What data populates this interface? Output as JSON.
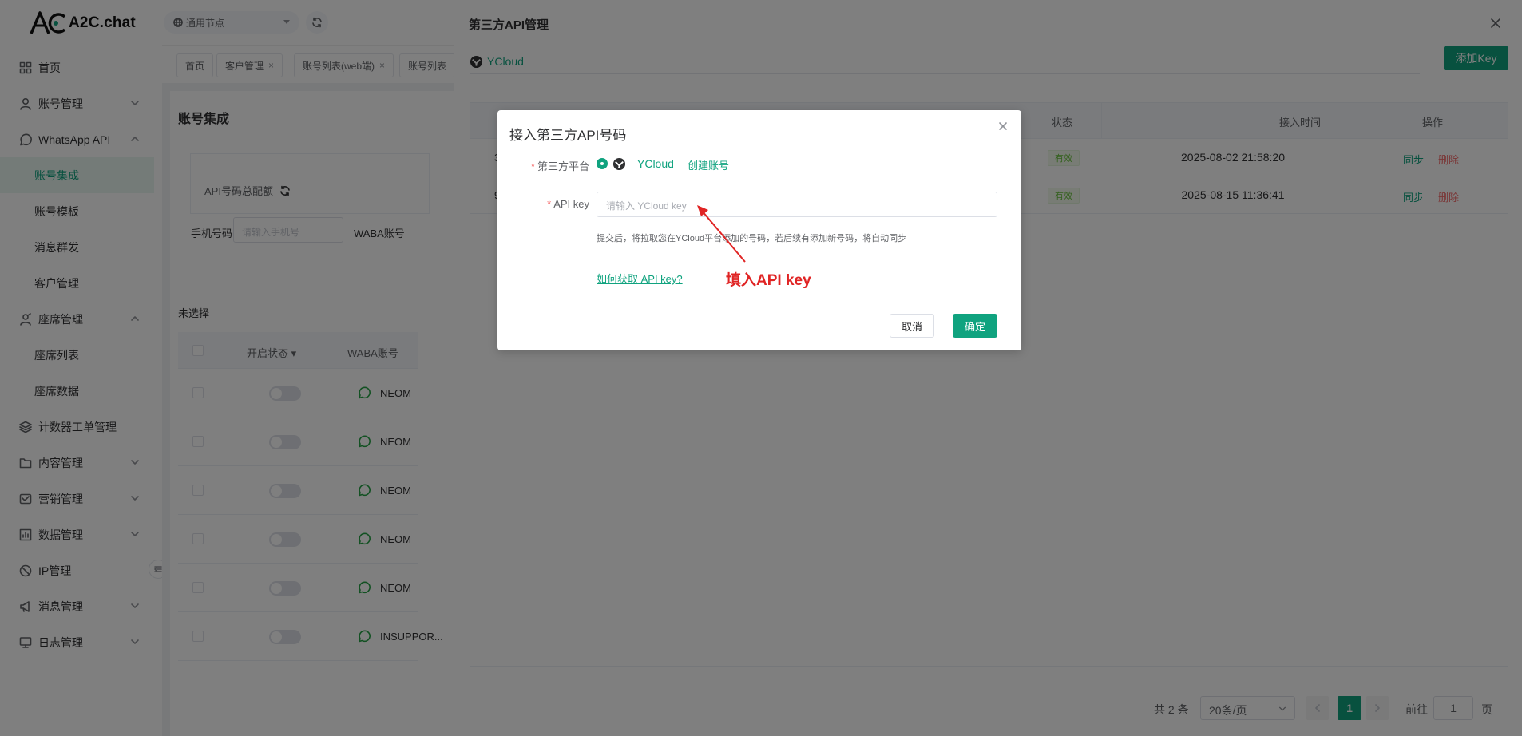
{
  "app": {
    "name": "A2C.chat"
  },
  "topbar": {
    "node_select": "通用节点"
  },
  "sidebar": {
    "items": [
      {
        "label": "首页",
        "icon": "grid-icon"
      },
      {
        "label": "账号管理",
        "icon": "user-icon"
      },
      {
        "label": "WhatsApp API",
        "icon": "whatsapp-icon"
      },
      {
        "label": "账号集成",
        "active": true
      },
      {
        "label": "账号模板"
      },
      {
        "label": "消息群发"
      },
      {
        "label": "客户管理"
      },
      {
        "label": "座席管理",
        "icon": "seat-icon"
      },
      {
        "label": "座席列表"
      },
      {
        "label": "座席数据"
      },
      {
        "label": "计数器工单管理",
        "icon": "layers-icon"
      },
      {
        "label": "内容管理",
        "icon": "folder-icon"
      },
      {
        "label": "营销管理",
        "icon": "marketing-icon"
      },
      {
        "label": "数据管理",
        "icon": "chart-icon"
      },
      {
        "label": "IP管理",
        "icon": "ip-icon"
      },
      {
        "label": "消息管理",
        "icon": "megaphone-icon"
      },
      {
        "label": "日志管理",
        "icon": "monitor-icon"
      }
    ]
  },
  "tabs": [
    {
      "label": "首页"
    },
    {
      "label": "客户管理",
      "close": "×"
    },
    {
      "label": "账号列表(web端)",
      "close": "×"
    },
    {
      "label": "账号列表"
    }
  ],
  "page": {
    "title": "账号集成",
    "quota_label": "API号码总配额",
    "filter": {
      "phone_label": "手机号码",
      "phone_placeholder": "请输入手机号",
      "waba_label": "WABA账号"
    },
    "selection": "未选择",
    "table": {
      "headers": [
        "开启状态",
        "WABA账号"
      ],
      "rows": [
        "NEOM",
        "NEOM",
        "NEOM",
        "NEOM",
        "NEOM",
        "INSUPPOR..."
      ]
    }
  },
  "drawer": {
    "title": "第三方API管理",
    "close": "×",
    "tab": "YCloud",
    "add_button": "添加Key",
    "table": {
      "headers": {
        "status": "状态",
        "time": "接入时间",
        "actions": "操作"
      },
      "rows": [
        {
          "cut": "3",
          "status": "有效",
          "time": "2025-08-02 21:58:20",
          "sync": "同步",
          "delete": "删除"
        },
        {
          "cut": "9",
          "status": "有效",
          "time": "2025-08-15 11:36:41",
          "sync": "同步",
          "delete": "删除"
        }
      ]
    },
    "pagination": {
      "total": "共 2 条",
      "page_size": "20条/页",
      "current": "1",
      "goto_label": "前往",
      "goto_value": "1",
      "page_suffix": "页"
    }
  },
  "modal": {
    "title": "接入第三方API号码",
    "close": "×",
    "platform_label": "第三方平台",
    "platform_name": "YCloud",
    "create_account": "创建账号",
    "apikey_label": "API key",
    "apikey_placeholder": "请输入 YCloud key",
    "hint": "提交后，将拉取您在YCloud平台添加的号码，若后续有添加新号码，将自动同步",
    "help_link": "如何获取 API key?",
    "annotation": "填入API key",
    "cancel": "取消",
    "confirm": "确定",
    "required_mark": "*"
  },
  "colors": {
    "accent": "#10a37f",
    "danger": "#f56c6c",
    "annotation": "#e02424"
  }
}
